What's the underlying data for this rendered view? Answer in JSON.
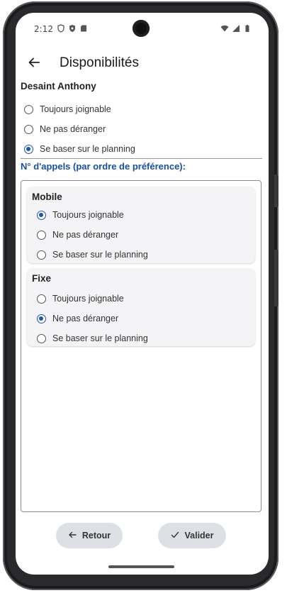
{
  "status_bar": {
    "time": "2:12",
    "left_icons": [
      "shield-outline-icon",
      "shield-filled-icon",
      "sd-card-icon"
    ],
    "right_icons": [
      "wifi-icon",
      "signal-icon",
      "battery-icon"
    ]
  },
  "app_bar": {
    "title": "Disponibilités",
    "back_icon": "arrow-left-icon"
  },
  "person": {
    "name": "Desaint Anthony",
    "options": [
      {
        "label": "Toujours joignable",
        "checked": false
      },
      {
        "label": "Ne pas déranger",
        "checked": false
      },
      {
        "label": "Se baser sur le planning",
        "checked": true
      }
    ]
  },
  "calls_section": {
    "label": "N° d'appels (par ordre de préférence):",
    "cards": [
      {
        "title": "Mobile",
        "options": [
          {
            "label": "Toujours joignable",
            "checked": true
          },
          {
            "label": "Ne pas déranger",
            "checked": false
          },
          {
            "label": "Se baser sur le planning",
            "checked": false
          }
        ]
      },
      {
        "title": "Fixe",
        "options": [
          {
            "label": "Toujours joignable",
            "checked": false
          },
          {
            "label": "Ne pas déranger",
            "checked": true
          },
          {
            "label": "Se baser sur le planning",
            "checked": false
          }
        ]
      }
    ]
  },
  "buttons": {
    "back_label": "Retour",
    "validate_label": "Valider"
  },
  "colors": {
    "accent": "#1a56b0",
    "section_label": "#1a4fa0",
    "button_bg": "#dde1e6"
  }
}
